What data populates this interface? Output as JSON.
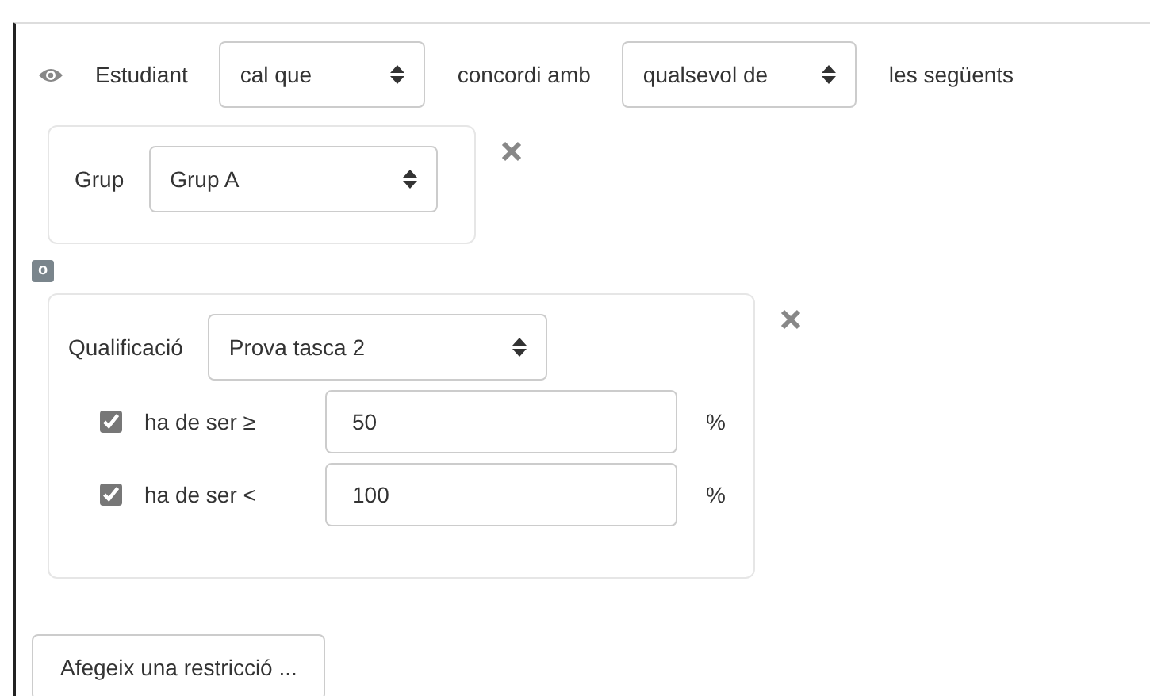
{
  "condition": {
    "visible": true,
    "label": "Estudiant",
    "mode": "cal que",
    "match_label": "concordi amb",
    "match": "qualsevol de",
    "trailing": "les següents"
  },
  "restrictions": [
    {
      "kind": "group",
      "label": "Grup",
      "value": "Grup A"
    },
    {
      "kind": "grade",
      "label": "Qualificació",
      "value": "Prova tasca 2",
      "limits": [
        {
          "checked": true,
          "label": "ha de ser ≥",
          "value": "50",
          "unit": "%"
        },
        {
          "checked": true,
          "label": "ha de ser <",
          "value": "100",
          "unit": "%"
        }
      ]
    }
  ],
  "connector": "o",
  "add_button": "Afegeix una restricció ..."
}
